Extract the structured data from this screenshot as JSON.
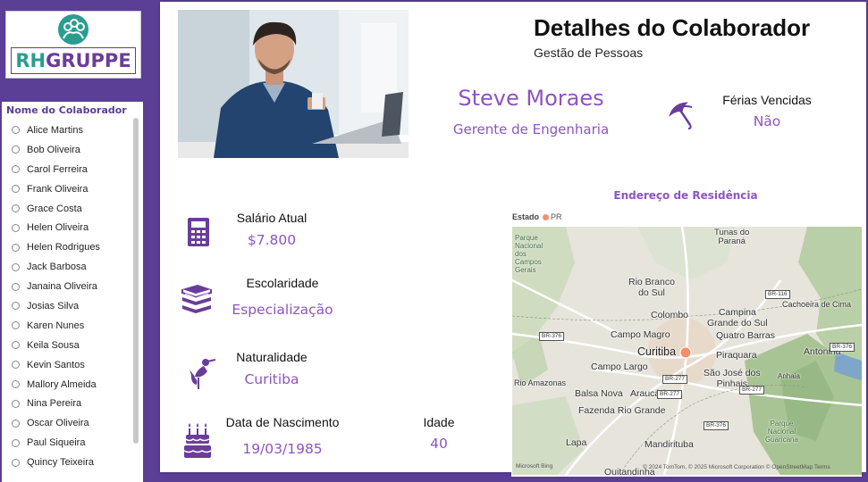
{
  "logo": {
    "text_a": "RH",
    "text_b": "GRUPPE"
  },
  "slicer": {
    "title": "Nome do Colaborador",
    "items": [
      "Alice Martins",
      "Bob Oliveira",
      "Carol Ferreira",
      "Frank Oliveira",
      "Grace Costa",
      "Helen Oliveira",
      "Helen Rodrigues",
      "Jack Barbosa",
      "Janaina Oliveira",
      "Josias Silva",
      "Karen Nunes",
      "Keila Sousa",
      "Kevin Santos",
      "Mallory Almeida",
      "Nina Pereira",
      "Oscar Oliveira",
      "Paul Siqueira",
      "Quincy Teixeira"
    ]
  },
  "header": {
    "title": "Detalhes do Colaborador",
    "subtitle": "Gestão de Pessoas"
  },
  "employee": {
    "name": "Steve Moraes",
    "role": "Gerente de Engenharia"
  },
  "vacation": {
    "label": "Férias Vencidas",
    "value": "Não"
  },
  "salary": {
    "label": "Salário Atual",
    "value": "$7.800"
  },
  "education": {
    "label": "Escolaridade",
    "value": "Especialização"
  },
  "birthplace": {
    "label": "Naturalidade",
    "value": "Curitiba"
  },
  "birth": {
    "label": "Data de Nascimento",
    "value": "19/03/1985"
  },
  "age": {
    "label": "Idade",
    "value": "40"
  },
  "map": {
    "title": "Endereço de Residência",
    "legend_label": "Estado",
    "legend_item": "PR",
    "labels": {
      "parque1": "Parque\nNacional\ndos\nCampos\nGerais",
      "tunas": "Tunas do\nParaná",
      "rio_branco": "Rio Branco\ndo Sul",
      "colombo": "Colombo",
      "campina": "Campina\nGrande do Sul",
      "cachoeira": "Cachoeira de Cima",
      "campo_magro": "Campo Magro",
      "quatro_barras": "Quatro Barras",
      "curitiba": "Curitiba",
      "piraquara": "Piraquara",
      "antonina": "Antonina",
      "campo_largo": "Campo Largo",
      "sao_jose": "São José dos\nPinhais",
      "anhaia": "Anhaia",
      "rio_amazonas": "Rio Amazonas",
      "balsa_nova": "Balsa Nova",
      "araucaria": "Araucária",
      "fazenda": "Fazenda Rio Grande",
      "parque2": "Parque\nNacional\nGuaricana",
      "lapa": "Lapa",
      "mandirituba": "Mandirituba",
      "quitandinha": "Quitandinha"
    },
    "roads": [
      "BR-116",
      "BR-376",
      "BR-277",
      "BR-277",
      "BR-277",
      "BR-376",
      "BR-376"
    ],
    "attribution": "© 2024 TomTom, © 2025 Microsoft Corporation  © OpenStreetMap  Terms",
    "bing": "Microsoft Bing"
  },
  "colors": {
    "accent": "#8e54c1",
    "background": "#5b3e96",
    "teal": "#2a9d8f"
  }
}
